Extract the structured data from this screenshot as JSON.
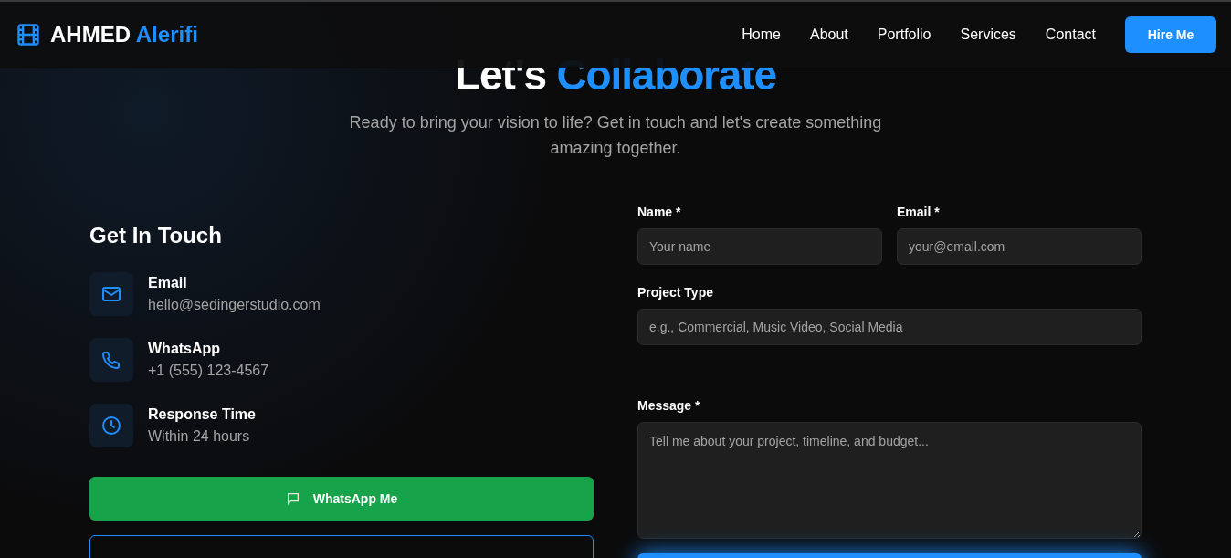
{
  "brand": {
    "plain": "AHMED",
    "accent": "Alerifi"
  },
  "nav": {
    "links": [
      "Home",
      "About",
      "Portfolio",
      "Services",
      "Contact"
    ],
    "cta": "Hire Me"
  },
  "hero": {
    "heading": {
      "plain": "Let's",
      "accent": "Collaborate"
    },
    "subtitle": "Ready to bring your vision to life? Get in touch and let's create something amazing together."
  },
  "contact": {
    "title": "Get In Touch",
    "items": [
      {
        "kind": "email",
        "label": "Email",
        "value": "hello@sedingerstudio.com"
      },
      {
        "kind": "phone",
        "label": "WhatsApp",
        "value": "+1 (555) 123-4567"
      },
      {
        "kind": "clock",
        "label": "Response Time",
        "value": "Within 24 hours"
      }
    ],
    "whatsapp_button": "WhatsApp Me"
  },
  "form": {
    "fields": [
      {
        "label": "Name *",
        "placeholder": "Your name"
      },
      {
        "label": "Email *",
        "placeholder": "your@email.com"
      },
      {
        "label": "Project Type",
        "placeholder": "e.g., Commercial, Music Video, Social Media"
      },
      {
        "label": "Message *",
        "placeholder": "Tell me about your project, timeline, and budget..."
      }
    ]
  }
}
